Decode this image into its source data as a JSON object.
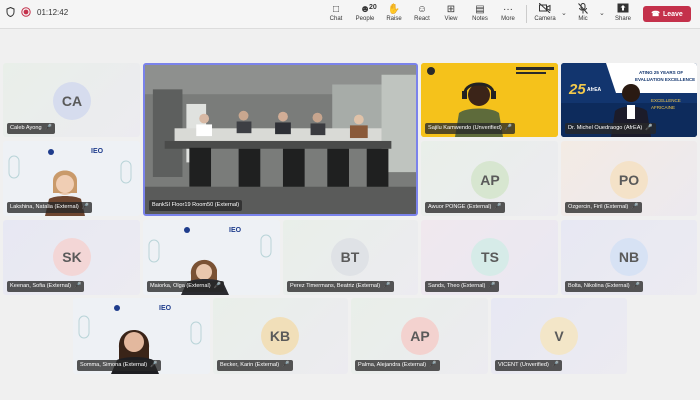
{
  "toolbar": {
    "timer": "01:12:42",
    "chat": "Chat",
    "people": "People",
    "people_count": "20",
    "raise": "Raise",
    "react": "React",
    "view": "View",
    "notes": "Notes",
    "more": "More",
    "camera": "Camera",
    "mic": "Mic",
    "share": "Share",
    "leave": "Leave"
  },
  "participants": {
    "caleb": {
      "initials": "CA",
      "name": "Caleb Ayong"
    },
    "bank": {
      "name": "BankSI Floor19 Room50 (External)"
    },
    "sajilu": {
      "name": "Sajilu Kamwendo (Unverified)"
    },
    "michel": {
      "name": "Dr. Michel Ouedraogo (AfrEA)",
      "banner_line1": "ATING 25 YEARS OF",
      "banner_line2": "EVALUATION EXCELLENCE",
      "banner_line3": "EXCELLENCE",
      "banner_line4": "AFRICAINE",
      "logo_text": "25",
      "org": "AfrEA"
    },
    "lakshina": {
      "name": "Lakshina, Natalia (External)"
    },
    "awuor": {
      "initials": "AP",
      "name": "Awuor PONGE (External)"
    },
    "ozgercin": {
      "initials": "PO",
      "name": "Ozgercin, Firil (External)"
    },
    "keenan": {
      "initials": "SK",
      "name": "Keenan, Sofia (External)"
    },
    "maiorka": {
      "name": "Maiorka, Olga (External)"
    },
    "perez": {
      "initials": "BT",
      "name": "Perez Timermans, Beatriz (External)"
    },
    "sands": {
      "initials": "TS",
      "name": "Sands, Theo (External)"
    },
    "bolta": {
      "initials": "NB",
      "name": "Bolta, Nikolina (External)"
    },
    "somma": {
      "name": "Somma, Simona (External)"
    },
    "becker": {
      "initials": "KB",
      "name": "Becker, Karin (External)"
    },
    "palma": {
      "initials": "AP",
      "name": "Palma, Alejandra (External)"
    },
    "vicent": {
      "initials": "V",
      "name": "VICENT (Unverified)"
    }
  },
  "logos": {
    "ied": "IEO"
  },
  "colors": {
    "leave_red": "#c4314b",
    "active_border": "#7b83eb",
    "yellow_bg": "#f7c31a",
    "blue_bg": "#12356e"
  }
}
